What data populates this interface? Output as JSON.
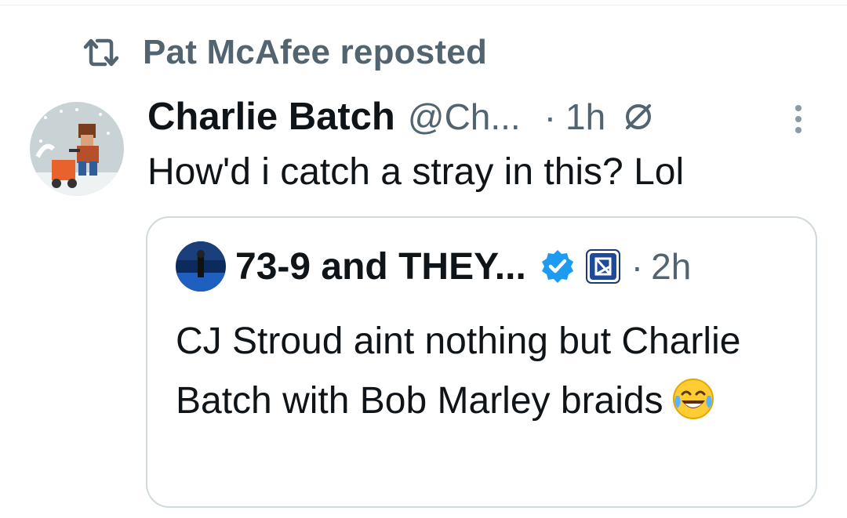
{
  "repost": {
    "text": "Pat McAfee reposted",
    "icon": "repost-icon"
  },
  "tweet": {
    "author_name": "Charlie Batch",
    "author_handle": "@Ch...",
    "separator": "·",
    "timestamp": "1h",
    "text": "How'd i catch a stray in this?  Lol"
  },
  "quote": {
    "author_name": "73-9 and THEY...",
    "separator": "·",
    "timestamp": "2h",
    "text": "CJ Stroud aint nothing but Charlie Batch with Bob Marley braids",
    "emoji": "face-with-tears-of-joy"
  },
  "colors": {
    "text_primary": "#0f1419",
    "text_secondary": "#536471",
    "verified_blue": "#1d9bf0",
    "border": "#cfd9de"
  }
}
